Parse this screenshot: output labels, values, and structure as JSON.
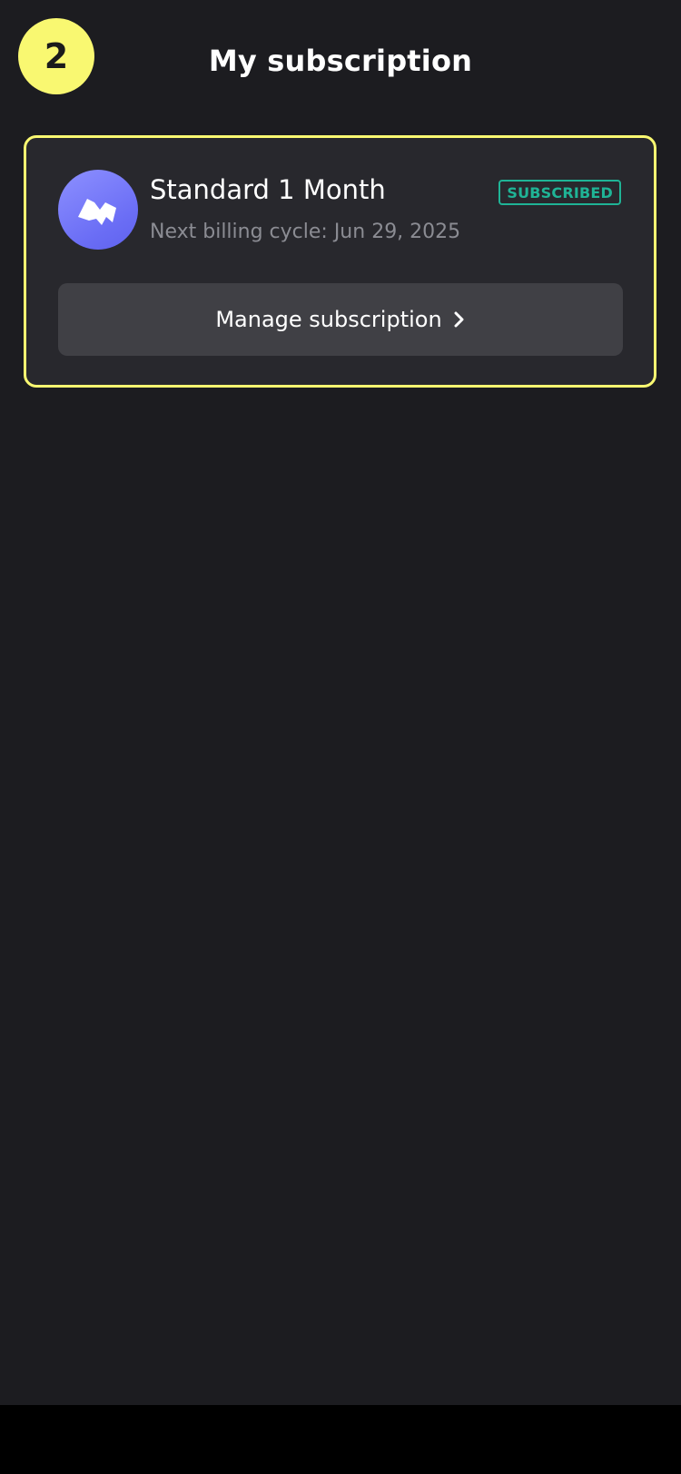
{
  "header": {
    "step_number": "2",
    "title": "My subscription"
  },
  "subscription": {
    "icon": "app-logo-icon",
    "plan_name": "Standard 1 Month",
    "billing_text": "Next billing cycle: Jun 29, 2025",
    "status": "SUBSCRIBED",
    "manage_label": "Manage subscription",
    "manage_icon": "chevron-right-icon"
  },
  "colors": {
    "background": "#1c1c20",
    "card_background": "#28282d",
    "highlight": "#f9f871",
    "status_green": "#1fb496",
    "avatar": "#6a6df5",
    "button_background": "#404045"
  }
}
